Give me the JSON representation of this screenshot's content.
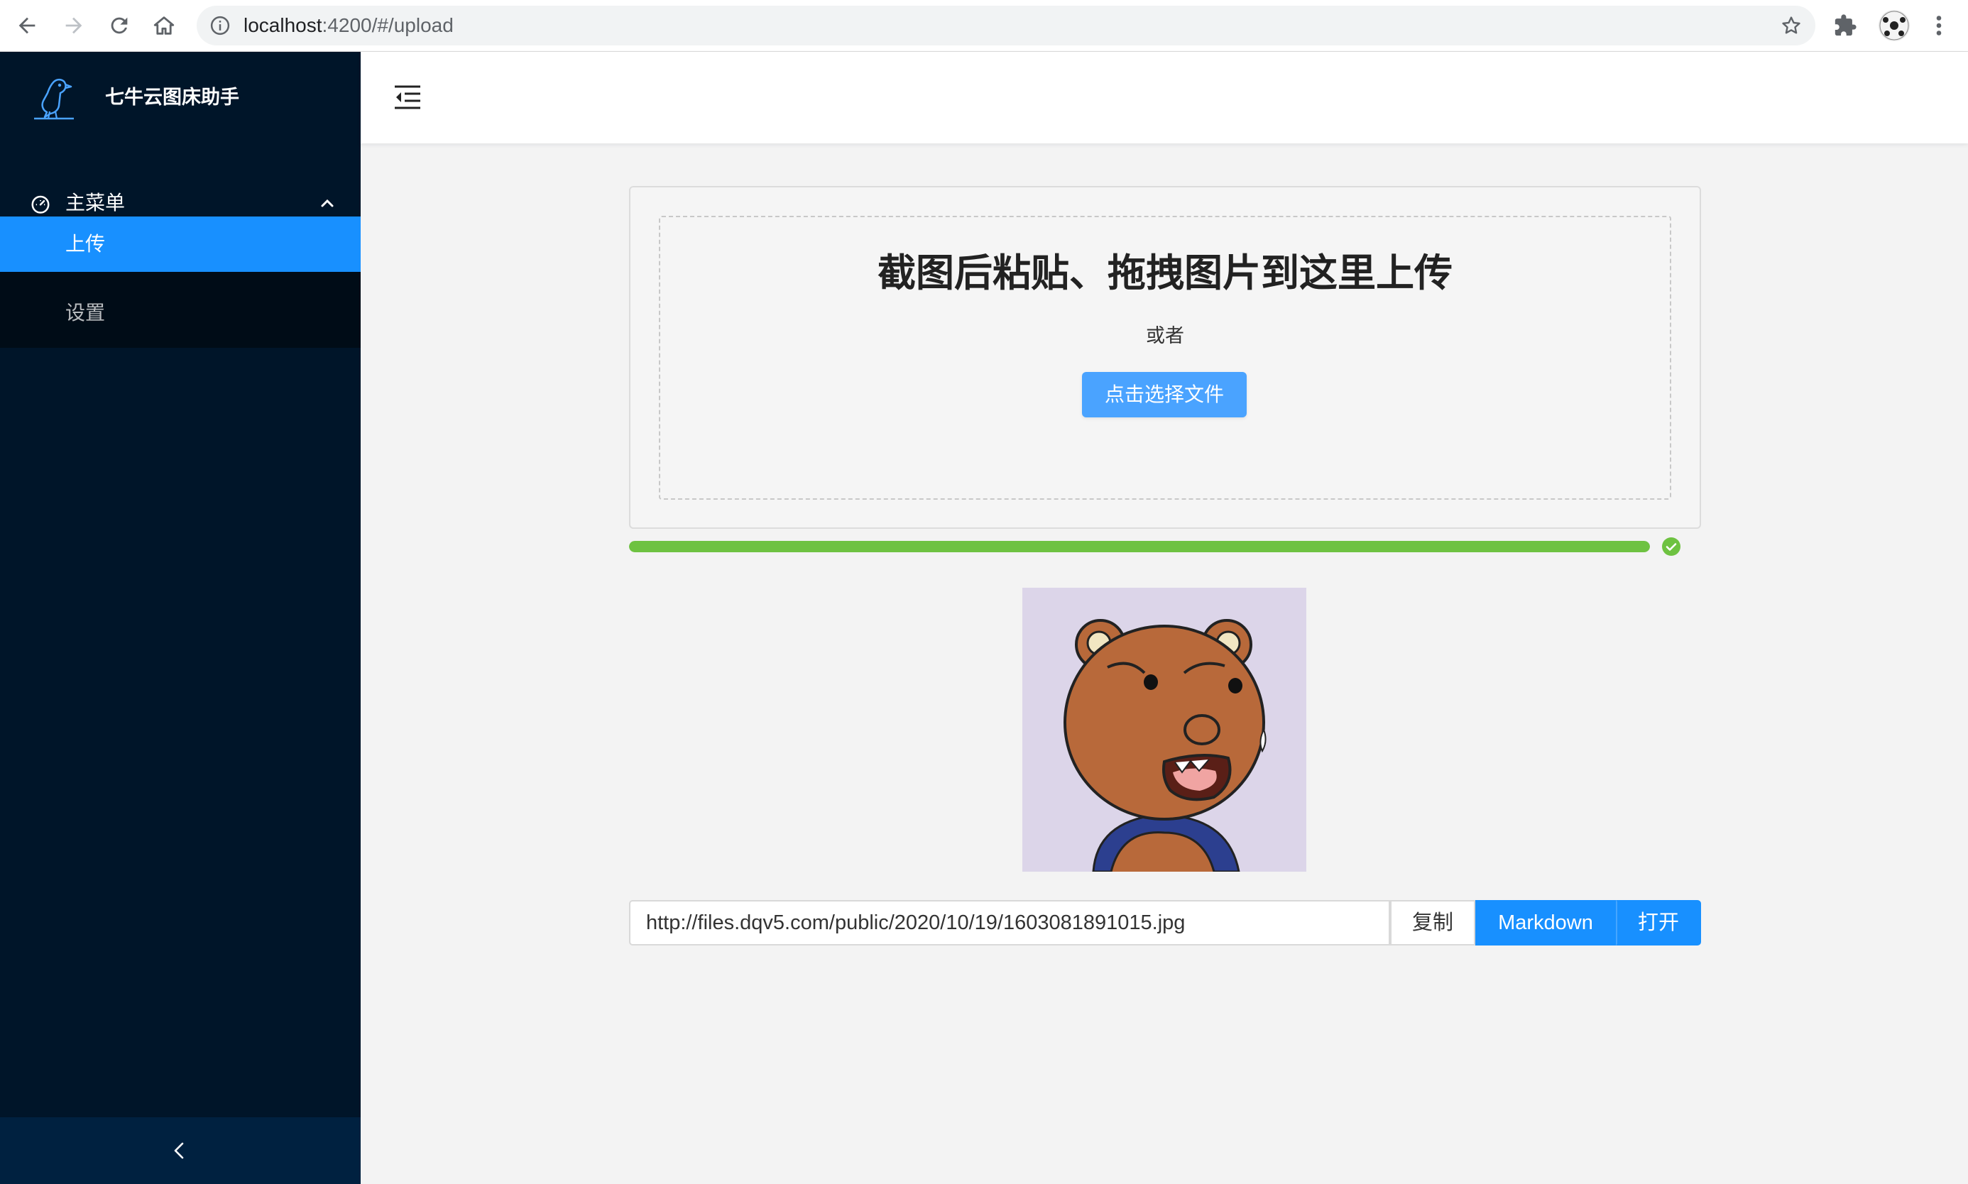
{
  "browser": {
    "url_host": "localhost",
    "url_path": ":4200/#/upload",
    "icons": [
      "back-arrow-icon",
      "forward-arrow-icon",
      "reload-icon",
      "home-icon",
      "info-icon",
      "star-icon",
      "puzzle-icon",
      "profile-avatar",
      "more-vert-icon"
    ]
  },
  "app": {
    "title": "七牛云图床助手",
    "logo_icon": "bird-logo-icon"
  },
  "sidebar": {
    "submenu_label": "主菜单",
    "submenu_icon": "dashboard-icon",
    "submenu_expanded": true,
    "items": [
      {
        "label": "上传",
        "active": true
      },
      {
        "label": "设置",
        "active": false
      }
    ]
  },
  "header": {
    "fold_icon": "menu-fold-icon"
  },
  "upload": {
    "title": "截图后粘贴、拖拽图片到这里上传",
    "or_text": "或者",
    "choose_button": "点击选择文件",
    "progress_percent": 100,
    "progress_status": "success"
  },
  "result": {
    "url": "http://files.dqv5.com/public/2020/10/19/1603081891015.jpg",
    "copy_label": "复制",
    "markdown_label": "Markdown",
    "open_label": "打开"
  },
  "colors": {
    "sidebar_bg": "#001529",
    "submenu_bg": "#000c17",
    "active_item": "#1890ff",
    "primary": "#1890ff",
    "progress": "#6ec241",
    "content_bg": "#f3f3f3"
  }
}
